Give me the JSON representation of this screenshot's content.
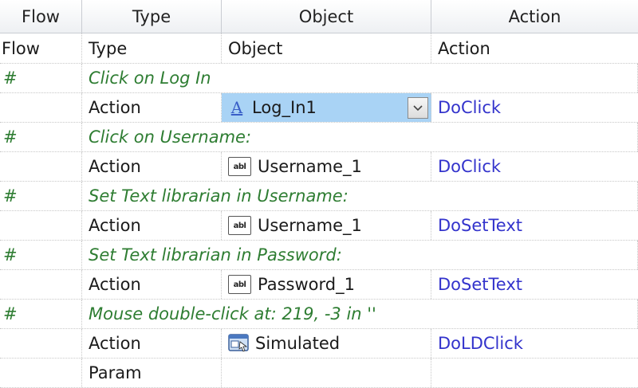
{
  "columns": [
    "Flow",
    "Type",
    "Object",
    "Action"
  ],
  "subheader": [
    "Flow",
    "Type",
    "Object",
    "Action"
  ],
  "rows": [
    {
      "flow": "#",
      "comment": "Click on Log In"
    },
    {
      "type": "Action",
      "object": "Log_In1",
      "object_icon": "link-icon",
      "action": "DoClick",
      "selected": true
    },
    {
      "flow": "#",
      "comment": "Click on Username:"
    },
    {
      "type": "Action",
      "object": "Username_1",
      "object_icon": "textbox-icon",
      "action": "DoClick"
    },
    {
      "flow": "#",
      "comment": "Set Text librarian in Username:"
    },
    {
      "type": "Action",
      "object": "Username_1",
      "object_icon": "textbox-icon",
      "action": "DoSetText"
    },
    {
      "flow": "#",
      "comment": "Set Text librarian in Password:"
    },
    {
      "type": "Action",
      "object": "Password_1",
      "object_icon": "textbox-icon",
      "action": "DoSetText"
    },
    {
      "flow": "#",
      "comment": "Mouse double-click at: 219, -3 in ''"
    },
    {
      "type": "Action",
      "object": "Simulated",
      "object_icon": "simulated-icon",
      "action": "DoLDClick"
    },
    {
      "type": "Param",
      "object": "",
      "action": ""
    }
  ],
  "icons": {
    "textbox_label": "abl",
    "link_glyph": "A"
  },
  "colors": {
    "comment": "#2e7d32",
    "action": "#3333cc",
    "selection": "#a9d3f5"
  }
}
